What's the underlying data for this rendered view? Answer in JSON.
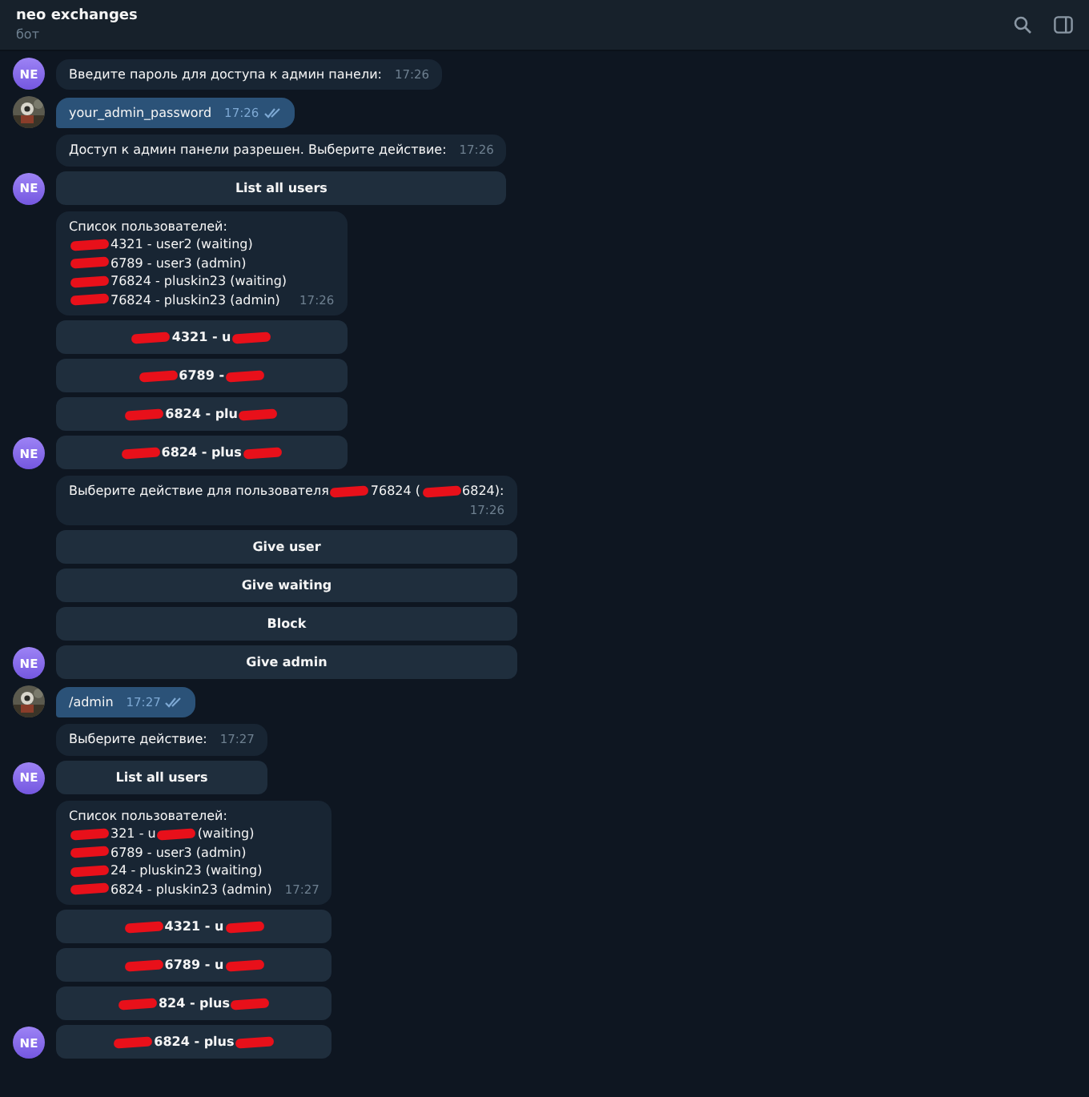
{
  "header": {
    "title": "neo exchanges",
    "subtitle": "бот"
  },
  "messages": [
    {
      "kind": "bot",
      "avatar": "NE",
      "parts": [
        {
          "kind": "text",
          "text": "Введите пароль для доступа к админ панели:"
        }
      ],
      "time": "17:26"
    },
    {
      "kind": "user",
      "parts": [
        {
          "kind": "text",
          "text": "your_admin_password"
        }
      ],
      "time": "17:26",
      "read": true
    },
    {
      "kind": "bot",
      "avatar": "NE",
      "parts": [
        {
          "kind": "text",
          "text": "Доступ к админ панели разрешен. Выберите действие:"
        }
      ],
      "time": "17:26",
      "buttons": [
        {
          "parts": [
            {
              "kind": "text",
              "text": "List all users"
            }
          ]
        }
      ]
    },
    {
      "kind": "bot",
      "avatar": "NE",
      "lines": [
        [
          {
            "kind": "text",
            "text": "Список пользователей:"
          }
        ],
        [
          {
            "kind": "redaction"
          },
          {
            "kind": "text",
            "text": "4321 - user2 (waiting)"
          }
        ],
        [
          {
            "kind": "redaction"
          },
          {
            "kind": "text",
            "text": "6789 - user3 (admin)"
          }
        ],
        [
          {
            "kind": "redaction"
          },
          {
            "kind": "text",
            "text": "76824 - pluskin23 (waiting)"
          }
        ],
        [
          {
            "kind": "redaction"
          },
          {
            "kind": "text",
            "text": "76824 - pluskin23 (admin)"
          }
        ]
      ],
      "time": "17:26",
      "buttons": [
        {
          "parts": [
            {
              "kind": "redaction"
            },
            {
              "kind": "text",
              "text": "4321 - u"
            },
            {
              "kind": "redaction"
            }
          ]
        },
        {
          "parts": [
            {
              "kind": "redaction"
            },
            {
              "kind": "text",
              "text": "6789 -"
            },
            {
              "kind": "redaction"
            }
          ]
        },
        {
          "parts": [
            {
              "kind": "redaction"
            },
            {
              "kind": "text",
              "text": "6824 - plu"
            },
            {
              "kind": "redaction"
            }
          ]
        },
        {
          "parts": [
            {
              "kind": "redaction"
            },
            {
              "kind": "text",
              "text": "6824 - plus"
            },
            {
              "kind": "redaction"
            }
          ]
        }
      ]
    },
    {
      "kind": "bot",
      "avatar": "NE",
      "parts": [
        {
          "kind": "text",
          "text": "Выберите действие для пользователя"
        },
        {
          "kind": "redaction"
        },
        {
          "kind": "text",
          "text": "76824 ("
        },
        {
          "kind": "redaction"
        },
        {
          "kind": "text",
          "text": "6824):"
        }
      ],
      "time": "17:26",
      "buttons": [
        {
          "parts": [
            {
              "kind": "text",
              "text": "Give user"
            }
          ]
        },
        {
          "parts": [
            {
              "kind": "text",
              "text": "Give waiting"
            }
          ]
        },
        {
          "parts": [
            {
              "kind": "text",
              "text": "Block"
            }
          ]
        },
        {
          "parts": [
            {
              "kind": "text",
              "text": "Give admin"
            }
          ]
        }
      ]
    },
    {
      "kind": "user",
      "parts": [
        {
          "kind": "text",
          "text": "/admin"
        }
      ],
      "time": "17:27",
      "read": true
    },
    {
      "kind": "bot",
      "avatar": "NE",
      "parts": [
        {
          "kind": "text",
          "text": "Выберите действие:"
        }
      ],
      "time": "17:27",
      "buttons": [
        {
          "parts": [
            {
              "kind": "text",
              "text": "List all users"
            }
          ]
        }
      ]
    },
    {
      "kind": "bot",
      "avatar": "NE",
      "lines": [
        [
          {
            "kind": "text",
            "text": "Список пользователей:"
          }
        ],
        [
          {
            "kind": "redaction"
          },
          {
            "kind": "text",
            "text": "321 - u"
          },
          {
            "kind": "redaction"
          },
          {
            "kind": "text",
            "text": "(waiting)"
          }
        ],
        [
          {
            "kind": "redaction"
          },
          {
            "kind": "text",
            "text": "6789 - user3 (admin)"
          }
        ],
        [
          {
            "kind": "redaction"
          },
          {
            "kind": "text",
            "text": "24 - pluskin23 (waiting)"
          }
        ],
        [
          {
            "kind": "redaction"
          },
          {
            "kind": "text",
            "text": "6824 - pluskin23 (admin)"
          }
        ]
      ],
      "time": "17:27",
      "buttons": [
        {
          "parts": [
            {
              "kind": "redaction"
            },
            {
              "kind": "text",
              "text": "4321 - u"
            },
            {
              "kind": "redaction"
            }
          ]
        },
        {
          "parts": [
            {
              "kind": "redaction"
            },
            {
              "kind": "text",
              "text": "6789 - u"
            },
            {
              "kind": "redaction"
            }
          ]
        },
        {
          "parts": [
            {
              "kind": "redaction"
            },
            {
              "kind": "text",
              "text": "824 - plus"
            },
            {
              "kind": "redaction"
            }
          ]
        },
        {
          "parts": [
            {
              "kind": "redaction"
            },
            {
              "kind": "text",
              "text": "6824 - plus"
            },
            {
              "kind": "redaction"
            }
          ]
        }
      ]
    }
  ]
}
